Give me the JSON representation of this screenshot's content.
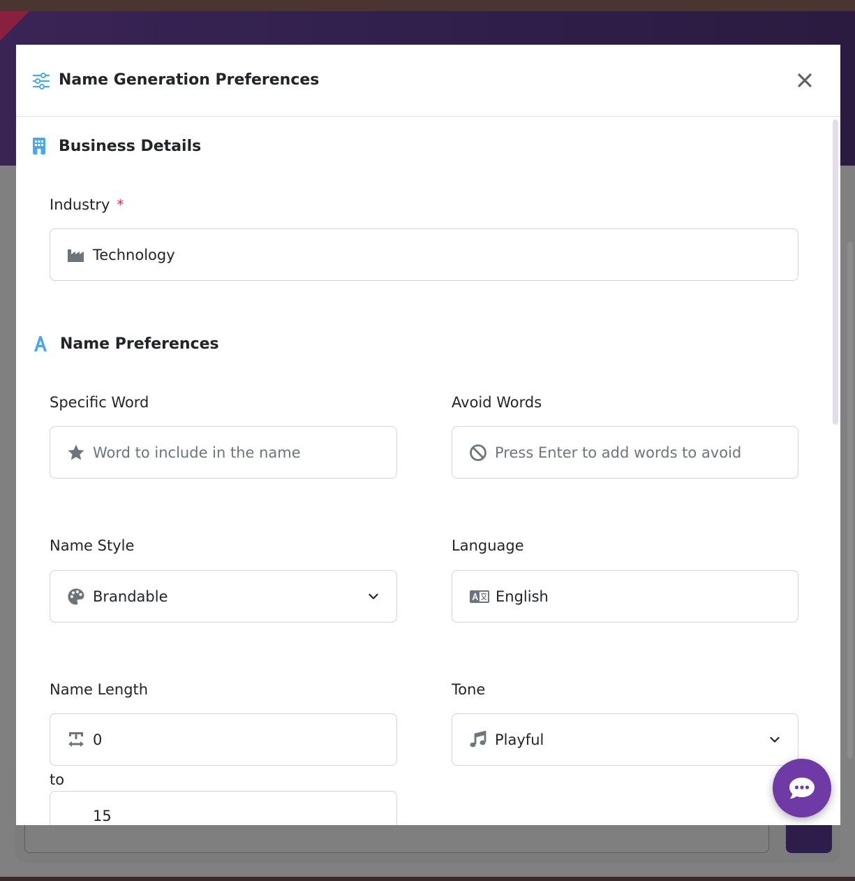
{
  "modal": {
    "title": "Name Generation Preferences",
    "close_icon": "close-icon"
  },
  "business_details": {
    "title": "Business Details",
    "icon": "building-icon",
    "industry": {
      "label": "Industry",
      "required_mark": "*",
      "icon": "industry-icon",
      "value": "Technology"
    }
  },
  "name_preferences": {
    "title": "Name Preferences",
    "icon": "font-icon",
    "specific_word": {
      "label": "Specific Word",
      "icon": "star-icon",
      "placeholder": "Word to include in the name"
    },
    "avoid_words": {
      "label": "Avoid Words",
      "icon": "ban-icon",
      "placeholder": "Press Enter to add words to avoid"
    },
    "name_style": {
      "label": "Name Style",
      "icon": "palette-icon",
      "value": "Brandable"
    },
    "language": {
      "label": "Language",
      "icon": "language-icon",
      "value": "English"
    },
    "name_length": {
      "label": "Name Length",
      "icon": "text-width-icon",
      "min": "0",
      "separator": "to",
      "max": "15"
    },
    "tone": {
      "label": "Tone",
      "icon": "music-icon",
      "value": "Playful"
    }
  },
  "chat": {
    "icon": "chat-bubble-icon"
  },
  "colors": {
    "accent_blue": "#4aa8e8",
    "chat_purple": "#6f3aa5",
    "required_red": "#dc3545"
  }
}
